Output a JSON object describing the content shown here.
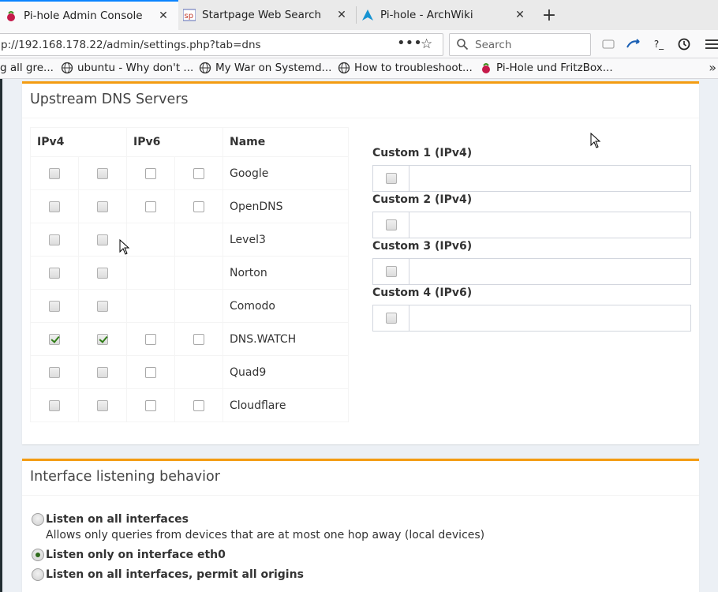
{
  "browser": {
    "tabs": [
      {
        "title": "Pi-hole Admin Console",
        "favicon": "raspberry-icon",
        "active": true
      },
      {
        "title": "Startpage Web Search",
        "favicon": "startpage-icon",
        "active": false
      },
      {
        "title": "Pi-hole - ArchWiki",
        "favicon": "arch-icon",
        "active": false
      }
    ],
    "url": "p://192.168.178.22/admin/settings.php?tab=dns",
    "search_placeholder": "Search",
    "bookmarks": [
      {
        "label": "g all gre..."
      },
      {
        "label": "ubuntu - Why don't ..."
      },
      {
        "label": "My War on Systemd..."
      },
      {
        "label": "How to troubleshoot..."
      },
      {
        "label": "Pi-Hole und FritzBox..."
      }
    ]
  },
  "upstream": {
    "title": "Upstream DNS Servers",
    "headers": {
      "ipv4": "IPv4",
      "ipv6": "IPv6",
      "name": "Name"
    },
    "servers": [
      {
        "name": "Google",
        "v4": [
          false,
          false
        ],
        "v6": [
          true,
          true
        ]
      },
      {
        "name": "OpenDNS",
        "v4": [
          false,
          false
        ],
        "v6": [
          true,
          true
        ]
      },
      {
        "name": "Level3",
        "v4": [
          false,
          false
        ],
        "v6": [
          null,
          null
        ]
      },
      {
        "name": "Norton",
        "v4": [
          false,
          false
        ],
        "v6": [
          null,
          null
        ]
      },
      {
        "name": "Comodo",
        "v4": [
          false,
          false
        ],
        "v6": [
          null,
          null
        ]
      },
      {
        "name": "DNS.WATCH",
        "v4": [
          true,
          true
        ],
        "v6": [
          false,
          false
        ]
      },
      {
        "name": "Quad9",
        "v4": [
          false,
          false
        ],
        "v6": [
          false,
          null
        ]
      },
      {
        "name": "Cloudflare",
        "v4": [
          false,
          false
        ],
        "v6": [
          false,
          false
        ]
      }
    ],
    "custom": [
      {
        "label": "Custom 1 (IPv4)",
        "value": ""
      },
      {
        "label": "Custom 2 (IPv4)",
        "value": ""
      },
      {
        "label": "Custom 3 (IPv6)",
        "value": ""
      },
      {
        "label": "Custom 4 (IPv6)",
        "value": ""
      }
    ]
  },
  "interface": {
    "title": "Interface listening behavior",
    "options": [
      {
        "label": "Listen on all interfaces",
        "desc": "Allows only queries from devices that are at most one hop away (local devices)",
        "checked": false
      },
      {
        "label": "Listen only on interface eth0",
        "desc": "",
        "checked": true
      },
      {
        "label": "Listen on all interfaces, permit all origins",
        "desc": "",
        "checked": false
      }
    ]
  },
  "colors": {
    "accent": "#f39c12",
    "tab_highlight": "#0a84ff",
    "page_bg": "#ecf0f5"
  }
}
